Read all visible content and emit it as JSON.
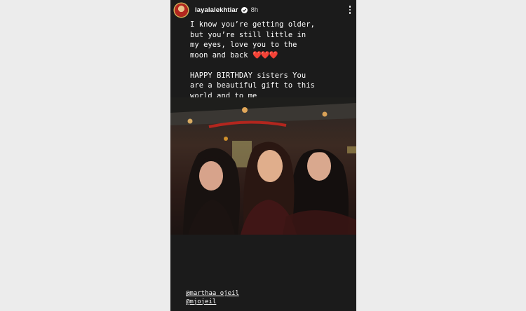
{
  "story": {
    "username": "layalalekhtiar",
    "time": "8h",
    "caption_line1": "I know you’re getting older,\nbut you’re still little in\nmy eyes, love you to the\nmoon and back ",
    "hearts": "❤️❤️❤️",
    "caption_line2": "\n\nHAPPY BIRTHDAY sisters You\nare a beautiful gift to this\nworld and to me",
    "mentions": [
      "@marthaa_ojeil",
      "@mjojeil"
    ]
  }
}
